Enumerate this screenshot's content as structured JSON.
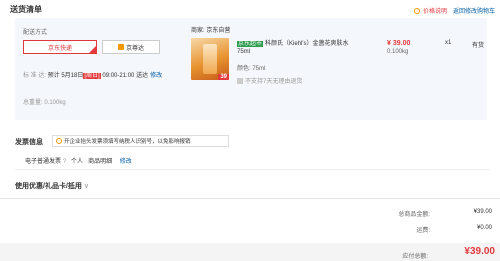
{
  "header": {
    "title": "送货清单",
    "price_note": "价格说明",
    "cart_link": "返回修改购物车"
  },
  "delivery": {
    "title": "配送方式",
    "options": [
      "京东快递",
      "京尊达"
    ],
    "time_label": "标 准 达: ",
    "time_prefix": "预计 5月18日",
    "time_tag": "[周日]",
    "time_suffix": " 09:00-21:00 送达",
    "modify": "修改",
    "weight_label": "总重量: ",
    "weight_value": "0.100kg"
  },
  "seller": {
    "label": "商家: 京东自营"
  },
  "product": {
    "tag": "京东超市",
    "name": "科颜氏（Kiehl's）金盏花爽肤水",
    "size": "75ml",
    "color": "颜色: 75ml",
    "no_return": "不支持7天无理由退货",
    "price": "¥ 39.00",
    "weight": "0.100kg",
    "qty": "x1",
    "stock": "有货",
    "image_badge": "39"
  },
  "invoice": {
    "title": "发票信息",
    "tip": "开企业抬头发票须填写纳税人识别号，以免影响报销",
    "type": "电子普通发票",
    "help_icon": "?",
    "personal": "个人",
    "detail": "商品明细",
    "edit": "修改"
  },
  "promo": {
    "title": "使用优惠/礼品卡/抵用",
    "chevron": "∨"
  },
  "summary": {
    "total_label": "总商品金额:",
    "total_value": "¥39.00",
    "shipping_label": "运费:",
    "shipping_value": "¥0.00",
    "pay_label": "应付总额:",
    "pay_value": "¥39.00"
  },
  "colors": {
    "accent": "#e4393c",
    "link": "#005ea7",
    "panel": "#f4f7fb"
  }
}
